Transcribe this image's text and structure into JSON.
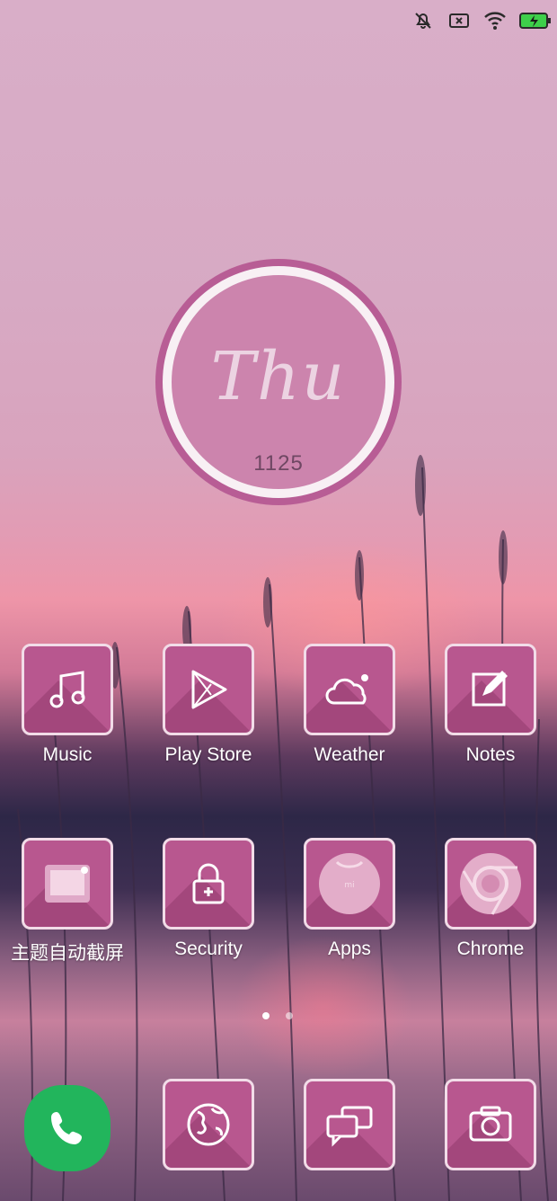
{
  "status_bar": {
    "icons": [
      "mute-icon",
      "sim-error-icon",
      "wifi-icon",
      "battery-charging-icon"
    ],
    "battery_color": "#3ecf4a"
  },
  "clock_widget": {
    "day": "Thu",
    "number": "1125"
  },
  "apps": [
    {
      "label": "Music",
      "icon": "music-note-icon"
    },
    {
      "label": "Play Store",
      "icon": "play-store-icon"
    },
    {
      "label": "Weather",
      "icon": "cloud-icon"
    },
    {
      "label": "Notes",
      "icon": "notes-edit-icon"
    },
    {
      "label": "主题自动截屏",
      "icon": "screenshot-icon"
    },
    {
      "label": "Security",
      "icon": "lock-icon"
    },
    {
      "label": "Apps",
      "icon": "mi-apps-icon"
    },
    {
      "label": "Chrome",
      "icon": "chrome-icon"
    }
  ],
  "page_indicator": {
    "total": 2,
    "current": 1
  },
  "dock": [
    {
      "icon": "phone-icon",
      "color": "#22b55c"
    },
    {
      "icon": "globe-icon"
    },
    {
      "icon": "messages-icon"
    },
    {
      "icon": "camera-icon"
    }
  ],
  "colors": {
    "tile": "#b8578f",
    "tile_border": "#f2dce8",
    "widget_ring": "#b85d95"
  }
}
